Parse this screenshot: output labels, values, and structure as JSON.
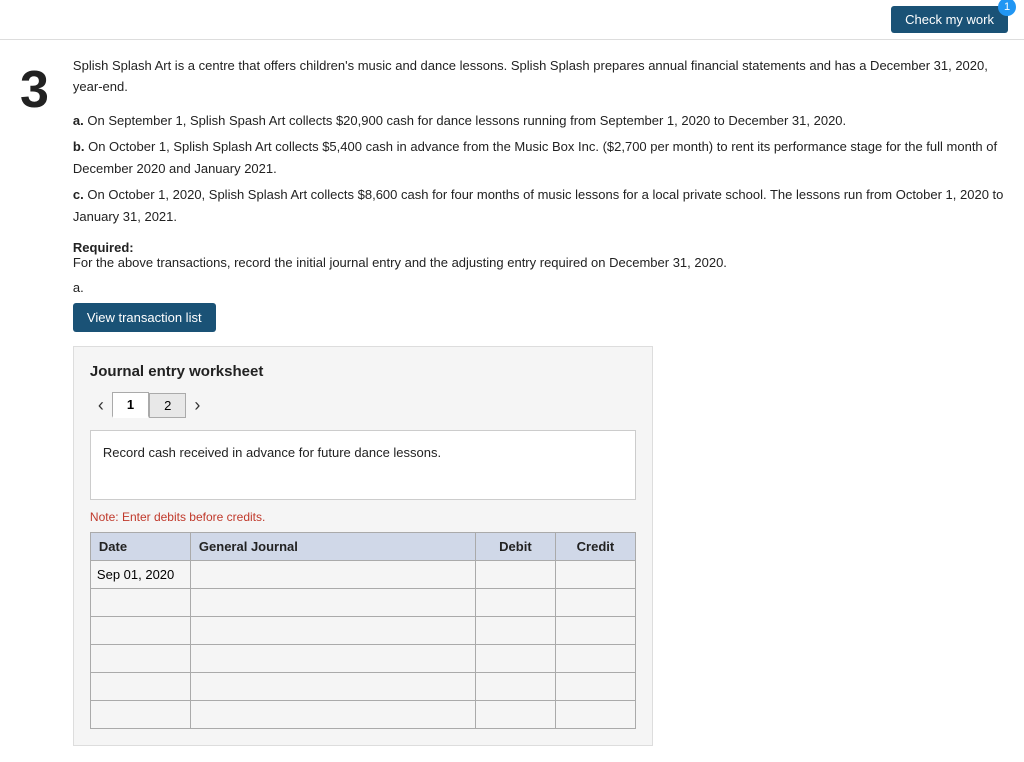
{
  "header": {
    "check_work_label": "Check my work",
    "badge_count": "1"
  },
  "question": {
    "number": "3",
    "intro": "Splish Splash Art is a centre that offers children's music and dance lessons. Splish Splash prepares annual financial statements and has a December 31, 2020, year-end.",
    "items": [
      {
        "label": "a.",
        "text": "On September 1, Splish Spash Art collects $20,900 cash for dance lessons running from September 1, 2020 to December 31, 2020."
      },
      {
        "label": "b.",
        "text": "On October 1, Splish Splash Art collects $5,400 cash in advance from the Music Box Inc. ($2,700 per month) to rent its performance stage for the full month of December 2020 and January 2021."
      },
      {
        "label": "c.",
        "text": "On October 1, 2020, Splish Splash Art collects $8,600 cash for four months of music lessons for a local private school. The lessons run from October 1, 2020 to January 31, 2021."
      }
    ],
    "required_label": "Required:",
    "required_text": "For the above transactions, record the initial journal entry and the adjusting entry required on December 31, 2020.",
    "section_label": "a.",
    "view_transaction_btn": "View transaction list"
  },
  "worksheet": {
    "title": "Journal entry worksheet",
    "tabs": [
      {
        "label": "1",
        "active": true
      },
      {
        "label": "2",
        "active": false
      }
    ],
    "instruction": "Record cash received in advance for future dance lessons.",
    "note": "Note: Enter debits before credits.",
    "table": {
      "headers": [
        "Date",
        "General Journal",
        "Debit",
        "Credit"
      ],
      "rows": [
        {
          "date": "Sep 01, 2020",
          "gj": "",
          "debit": "",
          "credit": ""
        },
        {
          "date": "",
          "gj": "",
          "debit": "",
          "credit": ""
        },
        {
          "date": "",
          "gj": "",
          "debit": "",
          "credit": ""
        },
        {
          "date": "",
          "gj": "",
          "debit": "",
          "credit": ""
        },
        {
          "date": "",
          "gj": "",
          "debit": "",
          "credit": ""
        },
        {
          "date": "",
          "gj": "",
          "debit": "",
          "credit": ""
        }
      ]
    }
  }
}
